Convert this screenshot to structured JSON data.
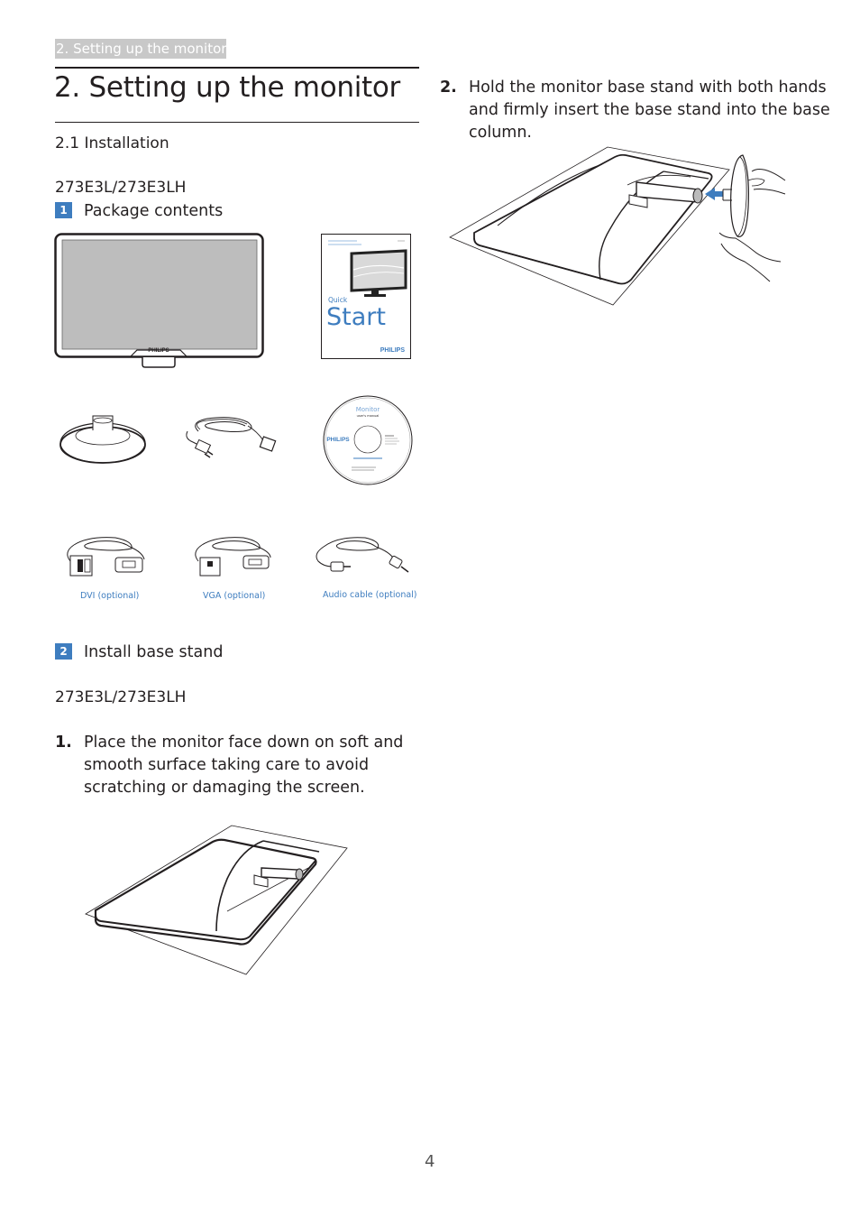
{
  "header": {
    "running_title": "2. Setting up the monitor"
  },
  "chapter": {
    "title": "2. Setting up the monitor"
  },
  "section": {
    "title": "2.1  Installation"
  },
  "package": {
    "model": "273E3L/273E3LH",
    "step_number": "1",
    "step_title": "Package contents",
    "items": [
      {
        "name": "Monitor",
        "brand": "PHILIPS"
      },
      {
        "name": "Quick Start guide",
        "label_small": "Quick",
        "label_large": "Start",
        "brand": "PHILIPS"
      },
      {
        "name": "Base stand"
      },
      {
        "name": "Power cord"
      },
      {
        "name": "CD",
        "title": "Monitor",
        "subtitle": "user's manual",
        "brand": "PHILIPS"
      }
    ],
    "captions": [
      "DVI (optional)",
      "VGA (optional)",
      "Audio cable (optional)"
    ]
  },
  "install": {
    "step_number": "2",
    "step_title": "Install base stand",
    "model": "273E3L/273E3LH",
    "steps": [
      {
        "num": "1.",
        "text": "Place the monitor face down on soft and smooth surface taking care to avoid scratching or damaging the screen."
      },
      {
        "num": "2.",
        "text": "Hold the monitor base stand with both hands and firmly insert the base stand into the base column."
      }
    ]
  },
  "colors": {
    "accent": "#3e7dbf",
    "header_tab_bg": "#c8c8c8",
    "text": "#231f20"
  },
  "footer": {
    "page_number": "4"
  }
}
